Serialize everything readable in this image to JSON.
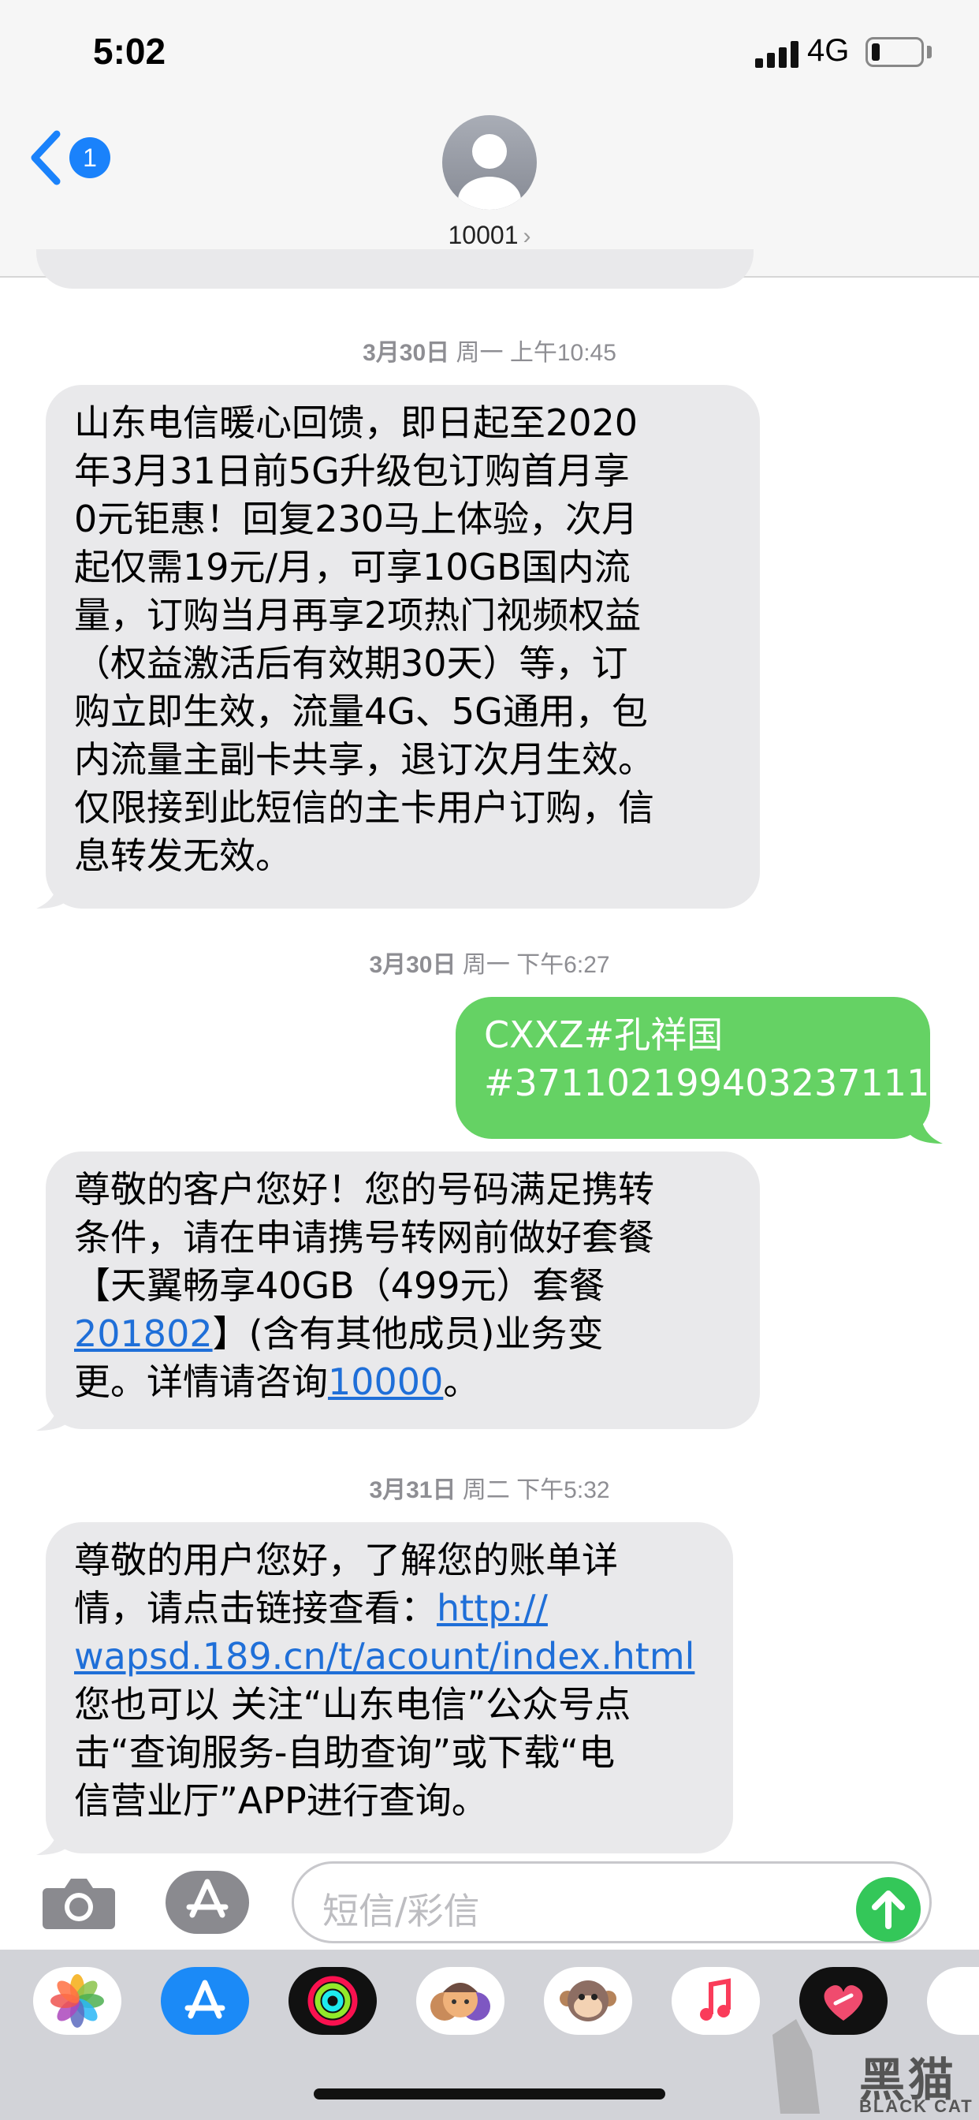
{
  "status_bar": {
    "time": "5:02",
    "network": "4G"
  },
  "header": {
    "back_badge": "1",
    "contact_name": "10001"
  },
  "messages": {
    "ts1_date": "3月30日",
    "ts1_rest": " 周一 上午10:45",
    "msg1": "山东电信暖心回馈，即日起至2020\n年3月31日前5G升级包订购首月享\n0元钜惠！回复230马上体验，次月\n起仅需19元/月，可享10GB国内流\n量，订购当月再享2项热门视频权益\n（权益激活后有效期30天）等，订\n购立即生效，流量4G、5G通用，包\n内流量主副卡共享，退订次月生效。\n仅限接到此短信的主卡用户订购，信\n息转发无效。",
    "ts2_date": "3月30日",
    "ts2_rest": " 周一 下午6:27",
    "msg2": "CXXZ#孔祥国\n#371102199403237111",
    "msg3_a": "尊敬的客户您好！您的号码满足携转\n条件，请在申请携号转网前做好套餐\n【天翼畅享40GB（499元）套餐\n",
    "msg3_link1": "201802",
    "msg3_b": "】(含有其他成员)业务变\n更。详情请咨询",
    "msg3_link2": "10000",
    "msg3_c": "。",
    "ts3_date": "3月31日",
    "ts3_rest": " 周二 下午5:32",
    "msg4_a": "尊敬的用户您好，了解您的账单详\n情，请点击链接查看：",
    "msg4_link": "http://\nwapsd.189.cn/t/acount/index.html",
    "msg4_b": "\n您也可以 关注“山东电信”公众号点\n击“查询服务-自助查询”或下载“电\n信营业厅”APP进行查询。"
  },
  "input": {
    "placeholder": "短信/彩信"
  },
  "app_drawer": {
    "apps": [
      "photos-icon",
      "app-store-icon",
      "activity-icon",
      "memoji-icon",
      "animoji-icon",
      "music-icon",
      "digital-touch-icon",
      "partial-app-icon"
    ]
  },
  "watermark": {
    "text": "黑猫",
    "sub": "BLACK CAT"
  },
  "colors": {
    "incoming_bubble": "#e9e9eb",
    "outgoing_bubble": "#65d264",
    "link": "#1f6fd8",
    "badge": "#1a82fb",
    "send": "#34c759"
  }
}
